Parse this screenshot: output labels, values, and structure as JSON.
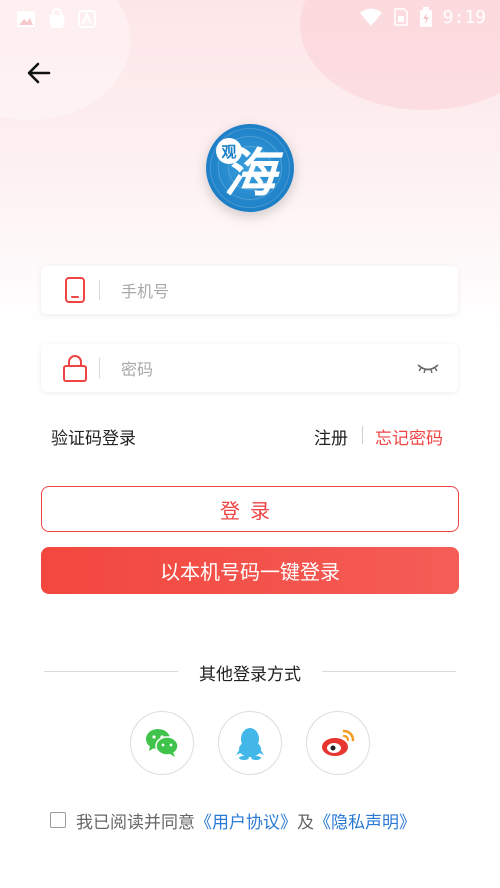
{
  "status": {
    "time": "9:19",
    "left_icons": [
      "image-icon",
      "shopping-bag-icon",
      "a-letter-icon"
    ],
    "right_icons": [
      "wifi-icon",
      "sim-icon",
      "battery-icon"
    ]
  },
  "header": {
    "back_icon": "arrow-left-icon"
  },
  "logo": {
    "small_char": "观",
    "big_char": "海",
    "color": "#1d7fc6"
  },
  "form": {
    "phone": {
      "placeholder": "手机号",
      "value": "",
      "icon": "phone-icon"
    },
    "password": {
      "placeholder": "密码",
      "value": "",
      "icon": "lock-icon",
      "toggle_icon": "eye-closed-icon"
    }
  },
  "links": {
    "sms_login": "验证码登录",
    "register": "注册",
    "forgot_password": "忘记密码"
  },
  "buttons": {
    "login": "登录",
    "one_key_login": "以本机号码一键登录"
  },
  "other": {
    "title": "其他登录方式",
    "providers": [
      "wechat-icon",
      "qq-icon",
      "weibo-icon"
    ]
  },
  "agreement": {
    "prefix": "我已阅读并同意",
    "user_agreement": "《用户协议》",
    "and": "及",
    "privacy_policy": "《隐私声明》",
    "checked": false
  },
  "colors": {
    "accent": "#ef4444",
    "link": "#2a79d4",
    "wechat": "#3fc34a",
    "qq": "#42b7e8",
    "weibo": "#e6362f"
  }
}
